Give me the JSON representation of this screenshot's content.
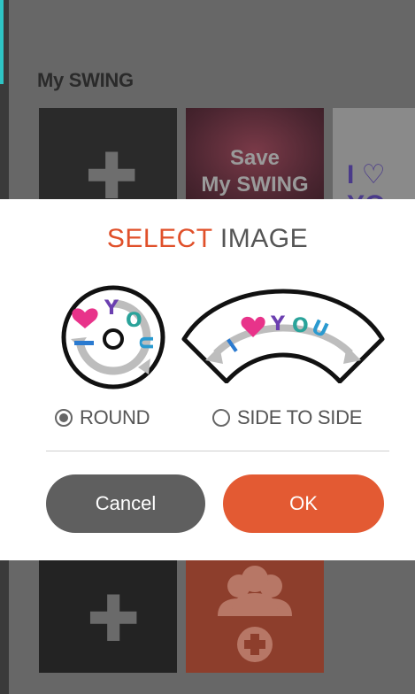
{
  "background": {
    "section_title": "My SWING",
    "tiles": {
      "add_icon": "plus-icon",
      "save_label_line1": "Save",
      "save_label_line2": "My SWING",
      "partial_text": "I ♡ YO"
    }
  },
  "dialog": {
    "title_accent": "SELECT",
    "title_rest": "IMAGE",
    "options": [
      {
        "label": "ROUND",
        "selected": true,
        "art_letters": "YOU"
      },
      {
        "label": "SIDE TO SIDE",
        "selected": false,
        "art_letters": "YOU"
      }
    ],
    "cancel_label": "Cancel",
    "ok_label": "OK"
  },
  "colors": {
    "accent": "#e0502a",
    "ok_button": "#e35a33",
    "cancel_button": "#5f5f5f"
  }
}
